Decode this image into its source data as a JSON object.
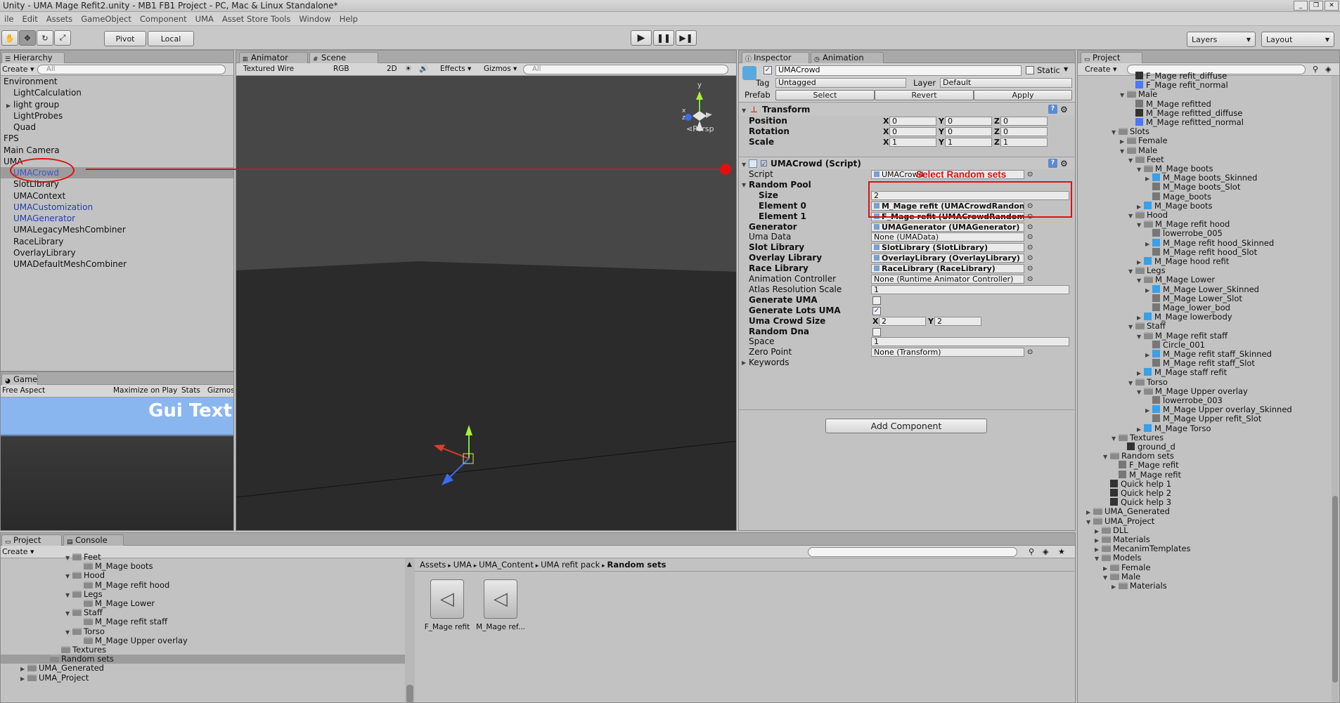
{
  "window": {
    "title": "Unity - UMA Mage Refit2.unity - MB1 FB1 Project - PC, Mac & Linux Standalone*"
  },
  "menu": [
    "ile",
    "Edit",
    "Assets",
    "GameObject",
    "Component",
    "UMA",
    "Asset Store Tools",
    "Window",
    "Help"
  ],
  "toolbar": {
    "pivot": "Pivot",
    "local": "Local",
    "layers": "Layers",
    "layout": "Layout"
  },
  "hierarchy": {
    "tab": "Hierarchy",
    "create": "Create",
    "search": "All",
    "items": [
      {
        "label": "Environment",
        "indent": 0,
        "blue": false,
        "fold": ""
      },
      {
        "label": "LightCalculation",
        "indent": 1,
        "blue": false,
        "fold": ""
      },
      {
        "label": "light group",
        "indent": 1,
        "blue": false,
        "fold": "▶"
      },
      {
        "label": "LightProbes",
        "indent": 1,
        "blue": false,
        "fold": ""
      },
      {
        "label": "Quad",
        "indent": 1,
        "blue": false,
        "fold": ""
      },
      {
        "label": "FPS",
        "indent": 0,
        "blue": false,
        "fold": ""
      },
      {
        "label": "Main Camera",
        "indent": 0,
        "blue": false,
        "fold": ""
      },
      {
        "label": "UMA",
        "indent": 0,
        "blue": false,
        "fold": ""
      },
      {
        "label": "UMACrowd",
        "indent": 1,
        "blue": true,
        "fold": ""
      },
      {
        "label": "SlotLibrary",
        "indent": 1,
        "blue": false,
        "fold": ""
      },
      {
        "label": "UMAContext",
        "indent": 1,
        "blue": false,
        "fold": ""
      },
      {
        "label": "UMACustomization",
        "indent": 1,
        "blue": true,
        "fold": ""
      },
      {
        "label": "UMAGenerator",
        "indent": 1,
        "blue": true,
        "fold": ""
      },
      {
        "label": "UMALegacyMeshCombiner",
        "indent": 1,
        "blue": false,
        "fold": ""
      },
      {
        "label": "RaceLibrary",
        "indent": 1,
        "blue": false,
        "fold": ""
      },
      {
        "label": "OverlayLibrary",
        "indent": 1,
        "blue": false,
        "fold": ""
      },
      {
        "label": "UMADefaultMeshCombiner",
        "indent": 1,
        "blue": false,
        "fold": ""
      }
    ]
  },
  "game": {
    "tab": "Game",
    "aspect": "Free Aspect",
    "maximize": "Maximize on Play",
    "stats": "Stats",
    "gizmos": "Gizmos",
    "gui_text": "Gui Text"
  },
  "scene": {
    "tab_animator": "Animator",
    "tab_scene": "Scene",
    "shading": "Textured Wire",
    "rgb": "RGB",
    "mode2d": "2D",
    "effects": "Effects",
    "gizmos": "Gizmos",
    "search": "All",
    "persp": "Persp"
  },
  "inspector": {
    "tab": "Inspector",
    "tab_animation": "Animation",
    "object_name": "UMACrowd",
    "static": "Static",
    "tag_label": "Tag",
    "tag": "Untagged",
    "layer_label": "Layer",
    "layer": "Default",
    "prefab_label": "Prefab",
    "select": "Select",
    "revert": "Revert",
    "apply": "Apply",
    "transform": {
      "title": "Transform",
      "rows": [
        {
          "label": "Position",
          "x": "0",
          "y": "0",
          "z": "0"
        },
        {
          "label": "Rotation",
          "x": "0",
          "y": "0",
          "z": "0"
        },
        {
          "label": "Scale",
          "x": "1",
          "y": "1",
          "z": "1"
        }
      ]
    },
    "script_title": "UMACrowd (Script)",
    "annotation": "Select Random sets",
    "fields": [
      {
        "label": "Script",
        "value": "UMACrowd",
        "bold": false,
        "indent": 0,
        "kind": "obj"
      },
      {
        "label": "Random Pool",
        "value": "",
        "bold": true,
        "indent": 0,
        "kind": "header"
      },
      {
        "label": "Size",
        "value": "2",
        "bold": true,
        "indent": 1,
        "kind": "text"
      },
      {
        "label": "Element 0",
        "value": "M_Mage refit (UMACrowdRandomSet)",
        "bold": true,
        "indent": 1,
        "kind": "obj"
      },
      {
        "label": "Element 1",
        "value": "F_Mage refit (UMACrowdRandomSet)",
        "bold": true,
        "indent": 1,
        "kind": "obj"
      },
      {
        "label": "Generator",
        "value": "UMAGenerator (UMAGenerator)",
        "bold": true,
        "indent": 0,
        "kind": "obj"
      },
      {
        "label": "Uma Data",
        "value": "None (UMAData)",
        "bold": false,
        "indent": 0,
        "kind": "obj"
      },
      {
        "label": "Slot Library",
        "value": "SlotLibrary (SlotLibrary)",
        "bold": true,
        "indent": 0,
        "kind": "obj"
      },
      {
        "label": "Overlay Library",
        "value": "OverlayLibrary (OverlayLibrary)",
        "bold": true,
        "indent": 0,
        "kind": "obj"
      },
      {
        "label": "Race Library",
        "value": "RaceLibrary (RaceLibrary)",
        "bold": true,
        "indent": 0,
        "kind": "obj"
      },
      {
        "label": "Animation Controller",
        "value": "None (Runtime Animator Controller)",
        "bold": false,
        "indent": 0,
        "kind": "obj"
      },
      {
        "label": "Atlas Resolution Scale",
        "value": "1",
        "bold": false,
        "indent": 0,
        "kind": "text"
      },
      {
        "label": "Generate UMA",
        "value": "",
        "bold": true,
        "indent": 0,
        "kind": "check"
      },
      {
        "label": "Generate Lots UMA",
        "value": "✓",
        "bold": true,
        "indent": 0,
        "kind": "check"
      },
      {
        "label": "Uma Crowd Size",
        "value": "",
        "bold": true,
        "indent": 0,
        "kind": "xy"
      },
      {
        "label": "Random Dna",
        "value": "",
        "bold": true,
        "indent": 0,
        "kind": "check"
      },
      {
        "label": "Space",
        "value": "1",
        "bold": false,
        "indent": 0,
        "kind": "text"
      },
      {
        "label": "Zero Point",
        "value": "None (Transform)",
        "bold": false,
        "indent": 0,
        "kind": "obj"
      },
      {
        "label": "Keywords",
        "value": "",
        "bold": false,
        "indent": 0,
        "kind": "fold"
      }
    ],
    "crowd_x": "2",
    "crowd_y": "2",
    "add_component": "Add Component"
  },
  "project_right": {
    "tab": "Project",
    "create": "Create",
    "items": [
      {
        "label": "F_Mage refit_diffuse",
        "indent": 5,
        "icon": "dicon",
        "fold": ""
      },
      {
        "label": "F_Mage refit_normal",
        "indent": 5,
        "icon": "nicon",
        "fold": ""
      },
      {
        "label": "Male",
        "indent": 4,
        "icon": "ficon",
        "fold": "▼"
      },
      {
        "label": "M_Mage refitted",
        "indent": 5,
        "icon": "gicon",
        "fold": ""
      },
      {
        "label": "M_Mage refitted_diffuse",
        "indent": 5,
        "icon": "dicon",
        "fold": ""
      },
      {
        "label": "M_Mage refitted_normal",
        "indent": 5,
        "icon": "nicon",
        "fold": ""
      },
      {
        "label": "Slots",
        "indent": 3,
        "icon": "ficon",
        "fold": "▼"
      },
      {
        "label": "Female",
        "indent": 4,
        "icon": "ficon",
        "fold": "▶"
      },
      {
        "label": "Male",
        "indent": 4,
        "icon": "ficon",
        "fold": "▼"
      },
      {
        "label": "Feet",
        "indent": 5,
        "icon": "ficon",
        "fold": "▼"
      },
      {
        "label": "M_Mage boots",
        "indent": 6,
        "icon": "ficon",
        "fold": "▼"
      },
      {
        "label": "M_Mage boots_Skinned",
        "indent": 7,
        "icon": "sicon",
        "fold": "▶"
      },
      {
        "label": "M_Mage boots_Slot",
        "indent": 7,
        "icon": "gicon",
        "fold": ""
      },
      {
        "label": "Mage_boots",
        "indent": 7,
        "icon": "gicon",
        "fold": ""
      },
      {
        "label": "M_Mage boots",
        "indent": 6,
        "icon": "sicon",
        "fold": "▶"
      },
      {
        "label": "Hood",
        "indent": 5,
        "icon": "ficon",
        "fold": "▼"
      },
      {
        "label": "M_Mage refit hood",
        "indent": 6,
        "icon": "ficon",
        "fold": "▼"
      },
      {
        "label": "lowerrobe_005",
        "indent": 7,
        "icon": "gicon",
        "fold": ""
      },
      {
        "label": "M_Mage refit hood_Skinned",
        "indent": 7,
        "icon": "sicon",
        "fold": "▶"
      },
      {
        "label": "M_Mage refit hood_Slot",
        "indent": 7,
        "icon": "gicon",
        "fold": ""
      },
      {
        "label": "M_Mage hood refit",
        "indent": 6,
        "icon": "sicon",
        "fold": "▶"
      },
      {
        "label": "Legs",
        "indent": 5,
        "icon": "ficon",
        "fold": "▼"
      },
      {
        "label": "M_Mage Lower",
        "indent": 6,
        "icon": "ficon",
        "fold": "▼"
      },
      {
        "label": "M_Mage Lower_Skinned",
        "indent": 7,
        "icon": "sicon",
        "fold": "▶"
      },
      {
        "label": "M_Mage Lower_Slot",
        "indent": 7,
        "icon": "gicon",
        "fold": ""
      },
      {
        "label": "Mage_lower_bod",
        "indent": 7,
        "icon": "gicon",
        "fold": ""
      },
      {
        "label": "M_Mage lowerbody",
        "indent": 6,
        "icon": "sicon",
        "fold": "▶"
      },
      {
        "label": "Staff",
        "indent": 5,
        "icon": "ficon",
        "fold": "▼"
      },
      {
        "label": "M_Mage refit staff",
        "indent": 6,
        "icon": "ficon",
        "fold": "▼"
      },
      {
        "label": "Circle_001",
        "indent": 7,
        "icon": "gicon",
        "fold": ""
      },
      {
        "label": "M_Mage refit staff_Skinned",
        "indent": 7,
        "icon": "sicon",
        "fold": "▶"
      },
      {
        "label": "M_Mage refit staff_Slot",
        "indent": 7,
        "icon": "gicon",
        "fold": ""
      },
      {
        "label": "M_Mage staff refit",
        "indent": 6,
        "icon": "sicon",
        "fold": "▶"
      },
      {
        "label": "Torso",
        "indent": 5,
        "icon": "ficon",
        "fold": "▼"
      },
      {
        "label": "M_Mage Upper overlay",
        "indent": 6,
        "icon": "ficon",
        "fold": "▼"
      },
      {
        "label": "lowerrobe_003",
        "indent": 7,
        "icon": "gicon",
        "fold": ""
      },
      {
        "label": "M_Mage Upper overlay_Skinned",
        "indent": 7,
        "icon": "sicon",
        "fold": "▶"
      },
      {
        "label": "M_Mage Upper refit_Slot",
        "indent": 7,
        "icon": "gicon",
        "fold": ""
      },
      {
        "label": "M_Mage Torso",
        "indent": 6,
        "icon": "sicon",
        "fold": "▶"
      },
      {
        "label": "Textures",
        "indent": 3,
        "icon": "ficon",
        "fold": "▼"
      },
      {
        "label": "ground_d",
        "indent": 4,
        "icon": "dicon",
        "fold": ""
      },
      {
        "label": "Random sets",
        "indent": 2,
        "icon": "ficon",
        "fold": "▼"
      },
      {
        "label": "F_Mage refit",
        "indent": 3,
        "icon": "gicon",
        "fold": ""
      },
      {
        "label": "M_Mage refit",
        "indent": 3,
        "icon": "gicon",
        "fold": ""
      },
      {
        "label": "Quick help 1",
        "indent": 2,
        "icon": "dicon",
        "fold": ""
      },
      {
        "label": "Quick help 2",
        "indent": 2,
        "icon": "dicon",
        "fold": ""
      },
      {
        "label": "Quick help 3",
        "indent": 2,
        "icon": "dicon",
        "fold": ""
      },
      {
        "label": "UMA_Generated",
        "indent": 0,
        "icon": "ficon",
        "fold": "▶"
      },
      {
        "label": "UMA_Project",
        "indent": 0,
        "icon": "ficon",
        "fold": "▼"
      },
      {
        "label": "DLL",
        "indent": 1,
        "icon": "ficon",
        "fold": "▶"
      },
      {
        "label": "Materials",
        "indent": 1,
        "icon": "ficon",
        "fold": "▶"
      },
      {
        "label": "MecanimTemplates",
        "indent": 1,
        "icon": "ficon",
        "fold": "▶"
      },
      {
        "label": "Models",
        "indent": 1,
        "icon": "ficon",
        "fold": "▼"
      },
      {
        "label": "Female",
        "indent": 2,
        "icon": "ficon",
        "fold": "▶"
      },
      {
        "label": "Male",
        "indent": 2,
        "icon": "ficon",
        "fold": "▼"
      },
      {
        "label": "Materials",
        "indent": 3,
        "icon": "ficon",
        "fold": "▶"
      }
    ]
  },
  "project_bottom": {
    "tab": "Project",
    "tab_console": "Console",
    "create": "Create",
    "breadcrumb": [
      "Assets",
      "UMA",
      "UMA_Content",
      "UMA refit pack",
      "Random sets"
    ],
    "tree": [
      {
        "label": "Feet",
        "indent": 5,
        "fold": "▼"
      },
      {
        "label": "M_Mage boots",
        "indent": 6,
        "fold": ""
      },
      {
        "label": "Hood",
        "indent": 5,
        "fold": "▼"
      },
      {
        "label": "M_Mage refit hood",
        "indent": 6,
        "fold": ""
      },
      {
        "label": "Legs",
        "indent": 5,
        "fold": "▼"
      },
      {
        "label": "M_Mage Lower",
        "indent": 6,
        "fold": ""
      },
      {
        "label": "Staff",
        "indent": 5,
        "fold": "▼"
      },
      {
        "label": "M_Mage refit staff",
        "indent": 6,
        "fold": ""
      },
      {
        "label": "Torso",
        "indent": 5,
        "fold": "▼"
      },
      {
        "label": "M_Mage Upper overlay",
        "indent": 6,
        "fold": ""
      },
      {
        "label": "Textures",
        "indent": 4,
        "fold": ""
      },
      {
        "label": "Random sets",
        "indent": 3,
        "fold": ""
      },
      {
        "label": "UMA_Generated",
        "indent": 1,
        "fold": "▶"
      },
      {
        "label": "UMA_Project",
        "indent": 1,
        "fold": "▶"
      }
    ],
    "assets": [
      "F_Mage refit",
      "M_Mage ref..."
    ]
  }
}
